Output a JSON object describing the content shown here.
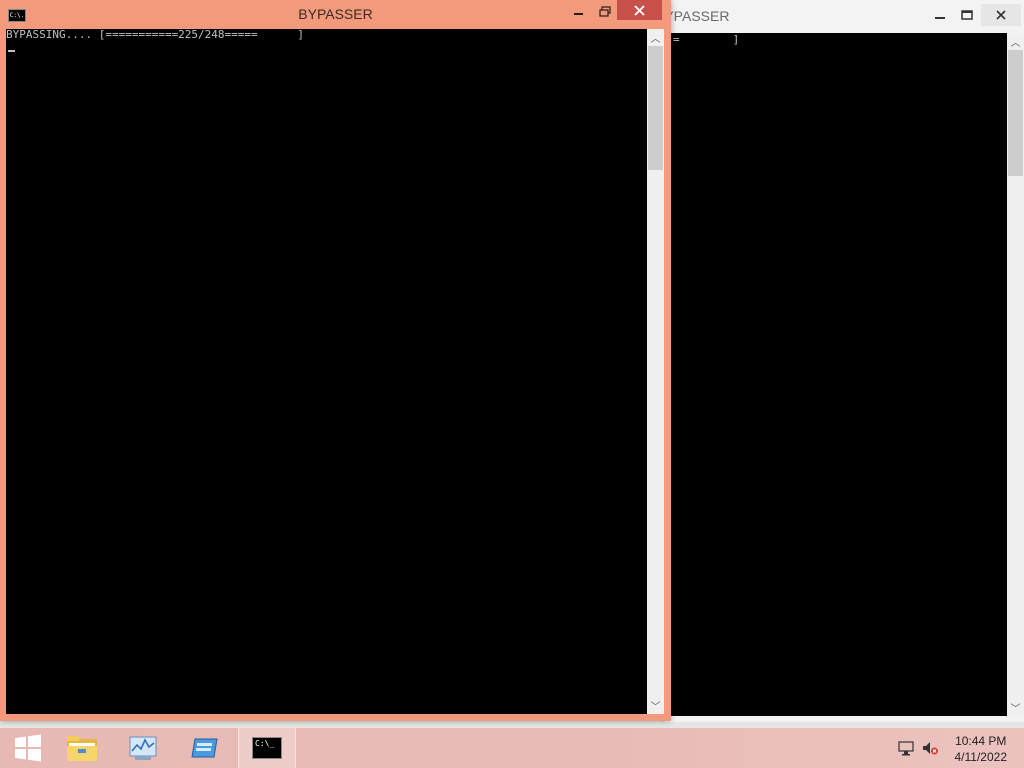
{
  "windows": {
    "background": {
      "title": "BYPASSER",
      "console_text": "=        ]"
    },
    "foreground": {
      "title": "BYPASSER",
      "app_icon_text": "C:\\.",
      "console_text": "BYPASSING.... [===========225/248=====      ]"
    }
  },
  "taskbar": {
    "pinned": [
      {
        "name": "start-icon"
      },
      {
        "name": "file-explorer-icon"
      },
      {
        "name": "performance-monitor-icon"
      },
      {
        "name": "server-manager-icon"
      },
      {
        "name": "command-prompt-icon",
        "label": "C:\\_"
      }
    ],
    "tray": {
      "time": "10:44 PM",
      "date": "4/11/2022"
    }
  },
  "colors": {
    "accent": "#f39a7c",
    "close": "#c7504a",
    "taskbar": "#e9bbb6"
  }
}
